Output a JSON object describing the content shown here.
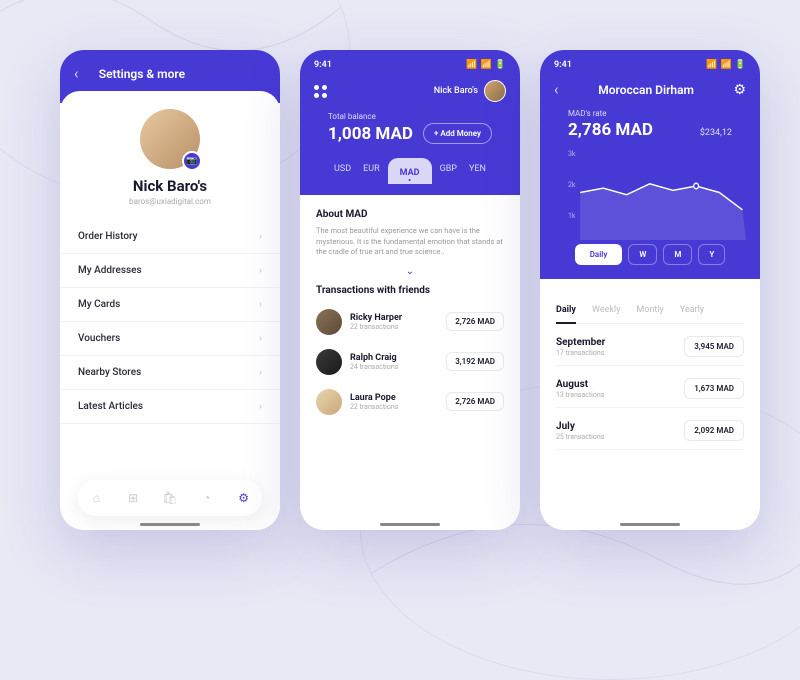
{
  "status": {
    "time": "9:41"
  },
  "phone1": {
    "title": "Settings & more",
    "name": "Nick Baro's",
    "email": "baros@uxiadigital.com",
    "menu": [
      "Order History",
      "My Addresses",
      "My Cards",
      "Vouchers",
      "Nearby Stores",
      "Latest Articles"
    ]
  },
  "phone2": {
    "user": "Nick Baro's",
    "balance_label": "Total balance",
    "balance": "1,008 MAD",
    "add_money": "+ Add Money",
    "currencies": [
      "USD",
      "EUR",
      "MAD",
      "GBP",
      "YEN"
    ],
    "active_currency": 2,
    "about_title": "About MAD",
    "about_desc": "The most beautiful experience we can have is the mysterious. It is the fundamental emotion that stands at the cradle of true art and true science..",
    "tx_title": "Transactions with friends",
    "tx": [
      {
        "name": "Ricky Harper",
        "sub": "22 transactions",
        "amt": "2,726 MAD",
        "color": "linear-gradient(135deg,#8b7355,#5a4a3a)"
      },
      {
        "name": "Ralph Craig",
        "sub": "24 transactions",
        "amt": "3,192 MAD",
        "color": "linear-gradient(135deg,#3a3a3a,#1a1a1a)"
      },
      {
        "name": "Laura Pope",
        "sub": "22 transactions",
        "amt": "2,726 MAD",
        "color": "linear-gradient(135deg,#e8d5b0,#c9a878)"
      }
    ]
  },
  "phone3": {
    "title": "Moroccan Dirham",
    "rate_label": "MAD's rate",
    "rate": "2,786 MAD",
    "usd": "$234,12",
    "seg": [
      "Daily",
      "W",
      "M",
      "Y"
    ],
    "tabs": [
      "Daily",
      "Weekly",
      "Montly",
      "Yearly"
    ],
    "months": [
      {
        "name": "September",
        "sub": "17 transactions",
        "amt": "3,945 MAD"
      },
      {
        "name": "August",
        "sub": "13 transactions",
        "amt": "1,673 MAD"
      },
      {
        "name": "July",
        "sub": "25 transactions",
        "amt": "2,092 MAD"
      }
    ]
  },
  "chart_data": {
    "type": "line",
    "title": "MAD's rate",
    "ylabel": "",
    "ylim": [
      0,
      3000
    ],
    "y_ticks": [
      "3k",
      "2k",
      "1k"
    ],
    "x": [
      0,
      1,
      2,
      3,
      4,
      5,
      6,
      7
    ],
    "values": [
      1500,
      1700,
      1400,
      1900,
      1600,
      1800,
      1500,
      700
    ],
    "highlight_index": 5
  }
}
